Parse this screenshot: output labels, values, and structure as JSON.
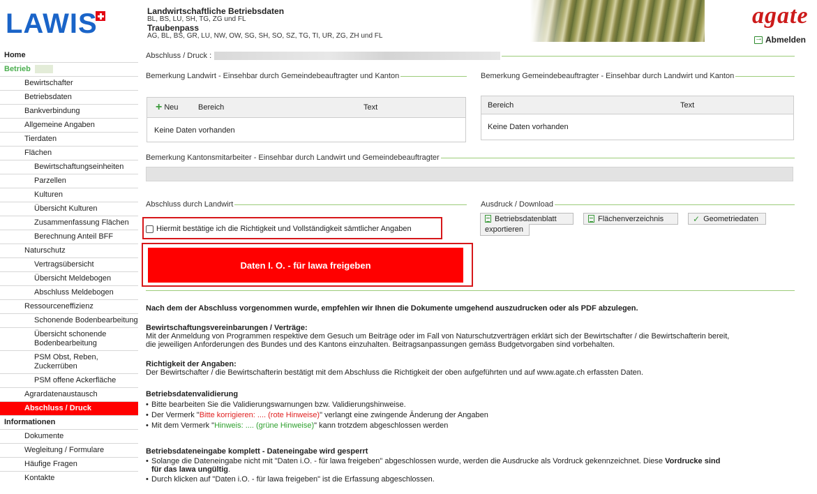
{
  "header": {
    "logo": "LAWIS",
    "title1": "Landwirtschaftliche Betriebsdaten",
    "cantons1": "BL, BS, LU, SH, TG, ZG und FL",
    "title2": "Traubenpass",
    "cantons2": "AG, BL, BS, GR, LU, NW, OW, SG, SH, SO, SZ, TG, TI, UR, ZG, ZH und FL",
    "brand": "agate",
    "logout": "Abmelden"
  },
  "sidebar": {
    "items": [
      {
        "label": "Home",
        "level": 0
      },
      {
        "label": "Betrieb",
        "level": 0
      },
      {
        "label": "Bewirtschafter",
        "level": 1
      },
      {
        "label": "Betriebsdaten",
        "level": 1
      },
      {
        "label": "Bankverbindung",
        "level": 1
      },
      {
        "label": "Allgemeine Angaben",
        "level": 1
      },
      {
        "label": "Tierdaten",
        "level": 1
      },
      {
        "label": "Flächen",
        "level": 1
      },
      {
        "label": "Bewirtschaftungseinheiten",
        "level": 2
      },
      {
        "label": "Parzellen",
        "level": 2
      },
      {
        "label": "Kulturen",
        "level": 2
      },
      {
        "label": "Übersicht Kulturen",
        "level": 2
      },
      {
        "label": "Zusammenfassung Flächen",
        "level": 2
      },
      {
        "label": "Berechnung Anteil BFF",
        "level": 2
      },
      {
        "label": "Naturschutz",
        "level": 1
      },
      {
        "label": "Vertragsübersicht",
        "level": 2
      },
      {
        "label": "Übersicht Meldebogen",
        "level": 2
      },
      {
        "label": "Abschluss Meldebogen",
        "level": 2
      },
      {
        "label": "Ressourceneffizienz",
        "level": 1
      },
      {
        "label": "Schonende Bodenbearbeitung",
        "level": 2
      },
      {
        "label": "Übersicht schonende Bodenbearbeitung",
        "level": 2
      },
      {
        "label": "PSM Obst, Reben, Zuckerrüben",
        "level": 2
      },
      {
        "label": "PSM offene Ackerfläche",
        "level": 2
      },
      {
        "label": "Agrardatenaustausch",
        "level": 1
      },
      {
        "label": "Abschluss / Druck",
        "level": 1
      },
      {
        "label": "Informationen",
        "level": 0
      },
      {
        "label": "Dokumente",
        "level": 1
      },
      {
        "label": "Wegleitung / Formulare",
        "level": 1
      },
      {
        "label": "Häufige Fragen",
        "level": 1
      },
      {
        "label": "Kontakte",
        "level": 1
      }
    ]
  },
  "main": {
    "page_legend": "Abschluss / Druck :",
    "remark_farmer": {
      "legend": "Bemerkung Landwirt - Einsehbar durch Gemeindebeauftragter und Kanton",
      "new_label": "Neu",
      "col_area": "Bereich",
      "col_text": "Text",
      "empty": "Keine Daten vorhanden"
    },
    "remark_municipal": {
      "legend": "Bemerkung Gemeindebeauftragter - Einsehbar durch Landwirt und Kanton",
      "col_area": "Bereich",
      "col_text": "Text",
      "empty": "Keine Daten vorhanden"
    },
    "remark_canton": {
      "legend": "Bemerkung Kantonsmitarbeiter - Einsehbar durch Landwirt und Gemeindebeauftragter"
    },
    "closing": {
      "legend": "Abschluss durch Landwirt",
      "confirm_label": "Hiermit bestätige ich die Richtigkeit und Vollständigkeit sämtlicher Angaben",
      "confirm_checked": false,
      "release_button": "Daten I. O. - für lawa freigeben"
    },
    "download": {
      "legend": "Ausdruck / Download",
      "btn_datasheet": "Betriebsdatenblatt",
      "btn_areas": "Flächenverzeichnis",
      "btn_geo_line1": "Geometriedaten",
      "btn_geo_line2": "exportieren"
    },
    "info": {
      "intro": "Nach dem der Abschluss vorgenommen wurde, empfehlen wir Ihnen die Dokumente umgehend auszudrucken oder als PDF abzulegen.",
      "agreements_title": "Bewirtschaftungsvereinbarungen / Verträge:",
      "agreements_text_1": "Mit der Anmeldung von Programmen respektive dem Gesuch um Beiträge oder im Fall von Naturschutzverträgen erklärt sich der Bewirtschafter / die Bewirtschafterin bereit,",
      "agreements_text_2": "die jeweiligen Anforderungen des Bundes und des Kantons einzuhalten. Beitragsanpassungen gemäss Budgetvorgaben sind vorbehalten.",
      "accuracy_title": "Richtigkeit der Angaben:",
      "accuracy_text": "Der Bewirtschafter / die Bewirtschafterin bestätigt mit dem Abschluss die Richtigkeit der oben aufgeführten und auf www.agate.ch erfassten Daten.",
      "validation_title": "Betriebsdatenvalidierung",
      "val_1": "Bitte bearbeiten Sie die Validierungswarnungen bzw. Validierungshinweise.",
      "val_2_a": "Der Vermerk \"",
      "val_2_red": "Bitte korrigieren: .... (rote Hinweise)",
      "val_2_b": "\" verlangt eine zwingende Änderung der Angaben",
      "val_3_a": "Mit dem Vermerk \"",
      "val_3_green": "Hinweis: .... (grüne Hinweise)",
      "val_3_b": "\" kann trotzdem abgeschlossen werden",
      "lock_title": "Betriebsdateneingabe komplett - Dateneingabe wird gesperrt",
      "lock_1_a": "Solange die Dateneingabe nicht mit \"Daten i.O. - für lawa freigeben\" abgeschlossen wurde, werden die Ausdrucke als Vordruck gekennzeichnet. Diese ",
      "lock_1_bold": "Vordrucke sind",
      "lock_1_bold2": "für das lawa ungültig",
      "lock_1_end": ".",
      "lock_2": "Durch klicken auf \"Daten i.O. - für lawa freigeben\" ist die Erfassung abgeschlossen."
    }
  }
}
